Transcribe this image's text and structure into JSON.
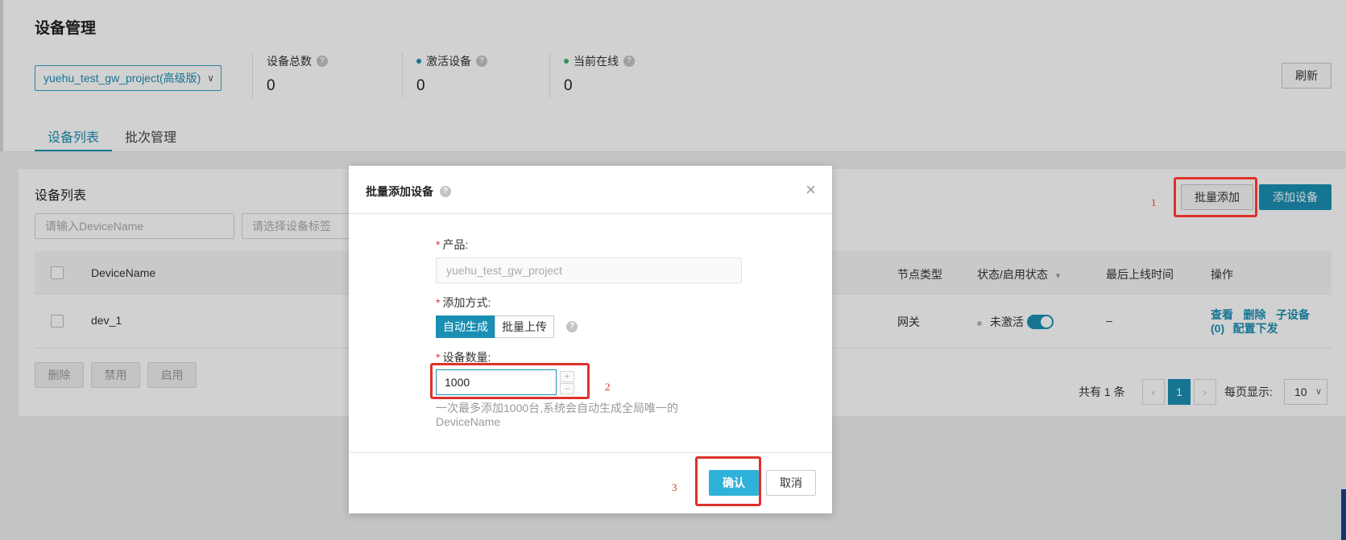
{
  "page": {
    "title": "设备管理",
    "project_select": "yuehu_test_gw_project(高级版)",
    "refresh_label": "刷新"
  },
  "stats": [
    {
      "label": "设备总数",
      "value": "0"
    },
    {
      "label": "激活设备",
      "value": "0",
      "dot_color": "#1a8fb4"
    },
    {
      "label": "当前在线",
      "value": "0",
      "dot_color": "#3cb371"
    }
  ],
  "tabs": [
    {
      "label": "设备列表",
      "active": true
    },
    {
      "label": "批次管理",
      "active": false
    }
  ],
  "list": {
    "title": "设备列表",
    "search_placeholder": "请输入DeviceName",
    "tag_placeholder": "请选择设备标签",
    "batch_add_label": "批量添加",
    "add_device_label": "添加设备",
    "columns": {
      "device_name": "DeviceName",
      "node_type": "节点类型",
      "status": "状态/启用状态",
      "last_online": "最后上线时间",
      "actions": "操作"
    },
    "rows": [
      {
        "device_name": "dev_1",
        "node_type": "网关",
        "status": "未激活",
        "enabled": true,
        "last_online": "–",
        "actions": [
          "查看",
          "删除",
          "子设备",
          "(0)",
          "配置下发"
        ]
      }
    ],
    "footer_buttons": [
      "删除",
      "禁用",
      "启用"
    ],
    "pagination": {
      "total_text": "共有 1 条",
      "prev": "‹",
      "current": "1",
      "next": "›",
      "page_size_label": "每页显示:",
      "page_size": "10"
    }
  },
  "dialog": {
    "title": "批量添加设备",
    "close": "×",
    "product_label": "产品:",
    "product_value": "yuehu_test_gw_project",
    "method_label": "添加方式:",
    "method_options": [
      "自动生成",
      "批量上传"
    ],
    "method_selected": "自动生成",
    "count_label": "设备数量:",
    "count_value": "1000",
    "stepper_plus": "+",
    "stepper_minus": "–",
    "hint": "一次最多添加1000台,系统会自动生成全局唯一的DeviceName",
    "confirm_label": "确认",
    "cancel_label": "取消"
  },
  "annotations": {
    "step1": "1",
    "step2": "2",
    "step3": "3",
    "color": "#e0302a"
  },
  "icons": {
    "help": "?",
    "chevron_down": "∨",
    "sort_caret": "▾"
  }
}
